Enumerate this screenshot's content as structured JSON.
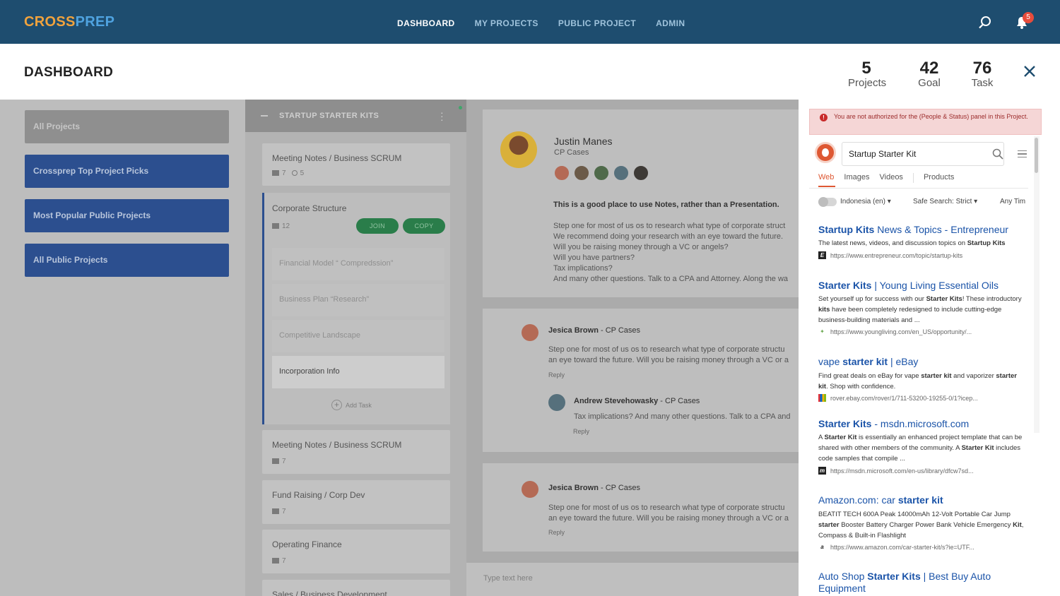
{
  "nav": {
    "logo_a": "CROSS",
    "logo_b": "PREP",
    "links": [
      "DASHBOARD",
      "MY PROJECTS",
      "PUBLIC PROJECT",
      "ADMIN"
    ],
    "notif_count": "5"
  },
  "header": {
    "title": "DASHBOARD",
    "stats": [
      {
        "num": "5",
        "label": "Projects"
      },
      {
        "num": "42",
        "label": "Goal"
      },
      {
        "num": "76",
        "label": "Task"
      }
    ]
  },
  "sidebar": {
    "items": [
      "All Projects",
      "Crossprep Top Project Picks",
      "Most Popular Public Projects",
      "All Public Projects"
    ]
  },
  "board": {
    "title": "STARTUP STARTER KITS",
    "cards": [
      {
        "title": "Meeting Notes / Business SCRUM",
        "comments": "7",
        "attachments": "5"
      },
      {
        "title": "Corporate Structure",
        "comments": "12",
        "join": "JOIN",
        "copy": "COPY"
      },
      {
        "title": "Meeting Notes / Business SCRUM",
        "comments": "7"
      },
      {
        "title": "Fund Raising / Corp Dev",
        "comments": "7"
      },
      {
        "title": "Operating Finance",
        "comments": "7"
      },
      {
        "title": "Sales / Business Development"
      }
    ],
    "subtasks": [
      "Financial Model “ Compredssion”",
      "Business Plan “Research”",
      "Competitive Landscape",
      "Incorporation Info"
    ],
    "add_task": "Add Task"
  },
  "notes": {
    "author": "Justin Manes",
    "author_sub": "CP Cases",
    "bold": "This is a good place to use Notes, rather than a Presentation.",
    "body": "Step one for most of us os to research what type of corporate struct\nWe recommend doing your research with an eye toward the future.\nWill you be raising money through a VC or angels?\nWill you have partners?\nTax implications?\nAnd many other questions. Talk to a CPA and Attorney. Along the wa",
    "comments": [
      {
        "name": "Jesica Brown",
        "sub": " - CP Cases",
        "body": "Step one for most of us os to research what type of corporate structu\nan eye toward the future. Will you be raising money through a VC or a",
        "reply": "Reply"
      },
      {
        "name": "Andrew Stevehowasky",
        "sub": " - CP Cases",
        "body": "Tax implications? And many other questions. Talk to a CPA and",
        "reply": "Reply"
      },
      {
        "name": "Jesica Brown",
        "sub": " - CP Cases",
        "body": "Step one for most of us os to research what type of corporate structu\nan eye toward the future. Will you be raising money through a VC or a",
        "reply": "Reply"
      }
    ],
    "type_placeholder": "Type text here"
  },
  "panel": {
    "alert": "You are not authorized for the (People & Status) panel in this Project.",
    "search_query": "Startup Starter Kit",
    "tabs": [
      "Web",
      "Images",
      "Videos",
      "Products"
    ],
    "filters": [
      "Indonesia (en)",
      "Safe Search: Strict",
      "Any Tim"
    ],
    "results": [
      {
        "t_bold": "Startup Kits",
        "t_rest": " News & Topics - Entrepreneur",
        "desc": "The latest news, videos, and discussion topics on <b>Startup Kits</b>",
        "url": "https://www.entrepreneur.com/topic/startup-kits"
      },
      {
        "t_bold": "Starter Kits",
        "t_rest": " | Young Living Essential Oils",
        "desc": "Set yourself up for success with our <b>Starter Kits</b>! These introductory <b>kits</b> have been completely redesigned to include cutting-edge business-building materials and ...",
        "url": "https://www.youngliving.com/en_US/opportunity/..."
      },
      {
        "t_pre": "vape ",
        "t_bold": "starter kit",
        "t_rest": " | eBay",
        "desc": "Find great deals on eBay for vape <b>starter kit</b> and vaporizer <b>starter kit</b>. Shop with confidence.",
        "url": "rover.ebay.com/rover/1/711-53200-19255-0/1?icep..."
      },
      {
        "t_bold": "Starter Kits",
        "t_rest": " - msdn.microsoft.com",
        "desc": "A <b>Starter Kit</b> is essentially an enhanced project template that can be shared with other members of the community. A <b>Starter Kit</b> includes code samples that compile ...",
        "url": "https://msdn.microsoft.com/en-us/library/dfcw7sd..."
      },
      {
        "t_pre": "Amazon.com: car ",
        "t_bold": "starter kit",
        "t_rest": "",
        "desc": "BEATIT TECH 600A Peak 14000mAh 12-Volt Portable Car Jump <b>starter</b> Booster Battery Charger Power Bank Vehicle Emergency <b>Kit</b>, Compass & Built-in Flashlight",
        "url": "https://www.amazon.com/car-starter-kit/s?ie=UTF..."
      },
      {
        "t_pre": "Auto Shop ",
        "t_bold": "Starter Kits",
        "t_rest": " | Best Buy Auto Equipment",
        "desc": "",
        "url": ""
      }
    ]
  }
}
